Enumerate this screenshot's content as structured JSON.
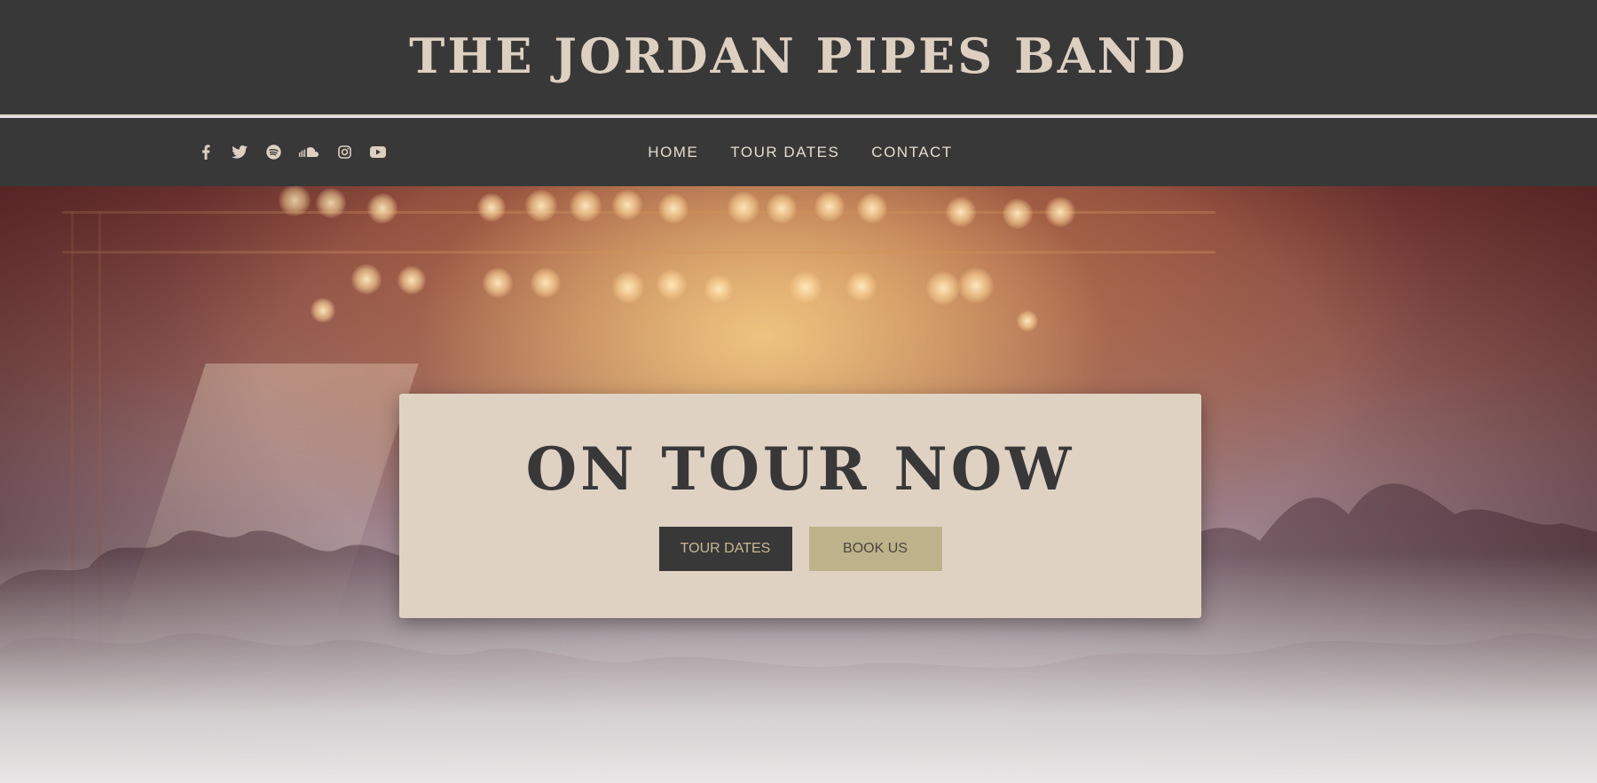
{
  "header": {
    "site_title": "THE JORDAN PIPES BAND"
  },
  "nav": {
    "social": [
      {
        "icon": "facebook-icon"
      },
      {
        "icon": "twitter-icon"
      },
      {
        "icon": "spotify-icon"
      },
      {
        "icon": "soundcloud-icon"
      },
      {
        "icon": "instagram-icon"
      },
      {
        "icon": "youtube-icon"
      }
    ],
    "links": [
      "HOME",
      "TOUR DATES",
      "CONTACT"
    ]
  },
  "hero": {
    "heading": "ON TOUR NOW",
    "buttons": {
      "tour_dates": "TOUR DATES",
      "book_us": "BOOK US"
    }
  },
  "colors": {
    "header_bg": "#383838",
    "accent_cream": "#ddd0c1",
    "card_bg": "#dfd2c3",
    "button_gold": "#bdb289"
  }
}
